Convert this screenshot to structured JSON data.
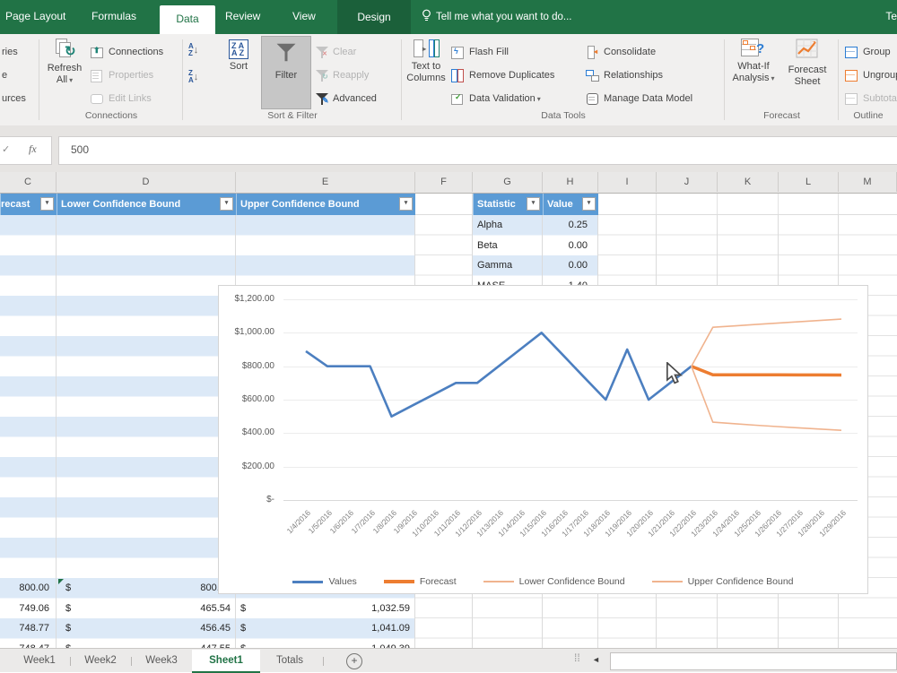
{
  "ribbon": {
    "tabs": [
      "Page Layout",
      "Formulas",
      "Data",
      "Review",
      "View",
      "Design"
    ],
    "active_tab": "Data",
    "tell_me": "Tell me what you want to do...",
    "account_partial": "Te",
    "cropped_labels": [
      "ries",
      "e",
      "urces"
    ],
    "groups": [
      {
        "name": "Connections",
        "items": [
          {
            "line1": "Refresh",
            "line2": "All",
            "arrow": "▾"
          },
          {
            "label": "Connections"
          },
          {
            "label": "Properties",
            "disabled": true
          },
          {
            "label": "Edit Links",
            "disabled": true
          }
        ]
      },
      {
        "name": "Sort & Filter",
        "items": [
          {
            "line1": "Sort",
            "line2": ""
          },
          {
            "line1": "Filter",
            "line2": ""
          },
          {
            "label": "Clear",
            "disabled": true
          },
          {
            "label": "Reapply",
            "disabled": true
          },
          {
            "label": "Advanced"
          }
        ]
      },
      {
        "name": "Data Tools",
        "items": [
          {
            "line1": "Text to",
            "line2": "Columns"
          },
          {
            "label": "Flash Fill"
          },
          {
            "label": "Remove Duplicates"
          },
          {
            "label": "Data Validation",
            "arrow": "▾"
          },
          {
            "label": "Consolidate"
          },
          {
            "label": "Relationships"
          },
          {
            "label": "Manage Data Model"
          }
        ]
      },
      {
        "name": "Forecast",
        "items": [
          {
            "line1": "What-If",
            "line2": "Analysis",
            "arrow": "▾"
          },
          {
            "line1": "Forecast",
            "line2": "Sheet"
          }
        ]
      },
      {
        "name": "Outline",
        "items": [
          {
            "label": "Group"
          },
          {
            "label": "Ungroup"
          },
          {
            "label": "Subtotal",
            "disabled": true
          }
        ]
      }
    ]
  },
  "formula_bar": {
    "fx_label": "fx",
    "value": "500"
  },
  "grid": {
    "column_letters": [
      "C",
      "D",
      "E",
      "F",
      "G",
      "H",
      "I",
      "J",
      "K",
      "L",
      "M"
    ],
    "table_headers": [
      {
        "col": "C",
        "label": "recast"
      },
      {
        "col": "D",
        "label": "Lower Confidence Bound"
      },
      {
        "col": "E",
        "label": "Upper Confidence Bound"
      }
    ],
    "stats_table": {
      "headers": [
        "Statistic",
        "Value"
      ],
      "rows": [
        [
          "Alpha",
          "0.25"
        ],
        [
          "Beta",
          "0.00"
        ],
        [
          "Gamma",
          "0.00"
        ],
        [
          "MASE",
          "1.40"
        ]
      ]
    },
    "bottom_rows": [
      {
        "c": "800.00",
        "d_sym": "$",
        "d": "800.00",
        "e_sym": "",
        "e": "",
        "flag": true
      },
      {
        "c": "749.06",
        "d_sym": "$",
        "d": "465.54",
        "e_sym": "$",
        "e": "1,032.59"
      },
      {
        "c": "748.77",
        "d_sym": "$",
        "d": "456.45",
        "e_sym": "$",
        "e": "1,041.09"
      },
      {
        "c": "748.47",
        "d_sym": "$",
        "d": "447.55",
        "e_sym": "$",
        "e": "1,049.39"
      }
    ]
  },
  "chart_data": {
    "type": "line",
    "x": [
      "1/4/2016",
      "1/5/2016",
      "1/6/2016",
      "1/7/2016",
      "1/8/2016",
      "1/9/2016",
      "1/10/2016",
      "1/11/2016",
      "1/12/2016",
      "1/13/2016",
      "1/14/2016",
      "1/15/2016",
      "1/16/2016",
      "1/17/2016",
      "1/18/2016",
      "1/19/2016",
      "1/20/2016",
      "1/21/2016",
      "1/22/2016",
      "1/23/2016",
      "1/24/2016",
      "1/25/2016",
      "1/26/2016",
      "1/27/2016",
      "1/28/2016",
      "1/29/2016"
    ],
    "series": [
      {
        "name": "Values",
        "color": "#4c7fc0",
        "width": 2.6,
        "start_index": 0,
        "values": [
          890,
          800,
          800,
          800,
          500,
          567,
          633,
          700,
          700,
          800,
          900,
          1000,
          867,
          733,
          600,
          900,
          600,
          700,
          800
        ]
      },
      {
        "name": "Forecast",
        "color": "#ed7d31",
        "width": 3.5,
        "start_index": 18,
        "values": [
          800,
          749.06,
          748.77,
          748.47,
          748.18,
          747.88,
          747.59,
          747.29
        ]
      },
      {
        "name": "Lower Confidence Bound",
        "color": "#f0b38e",
        "width": 1.6,
        "start_index": 18,
        "values": [
          800,
          465.54,
          456.45,
          447.55,
          439.5,
          431.7,
          424.2,
          417
        ]
      },
      {
        "name": "Upper Confidence Bound",
        "color": "#f0b38e",
        "width": 1.6,
        "start_index": 18,
        "values": [
          800,
          1032.59,
          1041.09,
          1049.39,
          1057.6,
          1065.7,
          1073.7,
          1081.6
        ]
      }
    ],
    "y_ticks": [
      {
        "label": "$1,200.00",
        "value": 1200
      },
      {
        "label": "$1,000.00",
        "value": 1000
      },
      {
        "label": "$800.00",
        "value": 800
      },
      {
        "label": "$600.00",
        "value": 600
      },
      {
        "label": "$400.00",
        "value": 400
      },
      {
        "label": "$200.00",
        "value": 200
      },
      {
        "label": "$-",
        "value": 0
      }
    ],
    "ylim": [
      0,
      1200
    ],
    "grid": true,
    "legend_position": "bottom"
  },
  "sheet_tabs": {
    "tabs": [
      "Week1",
      "Week2",
      "Week3",
      "Sheet1",
      "Totals"
    ],
    "active": "Sheet1",
    "add_label": "+"
  },
  "icons": {
    "dropdown": "▾",
    "check": "✓",
    "refresh": "↻",
    "add_sheet": "+",
    "scroll_left": "◄",
    "splitter": "⁞⁞",
    "pencil": "✎",
    "question": "?",
    "cross": "✕"
  }
}
